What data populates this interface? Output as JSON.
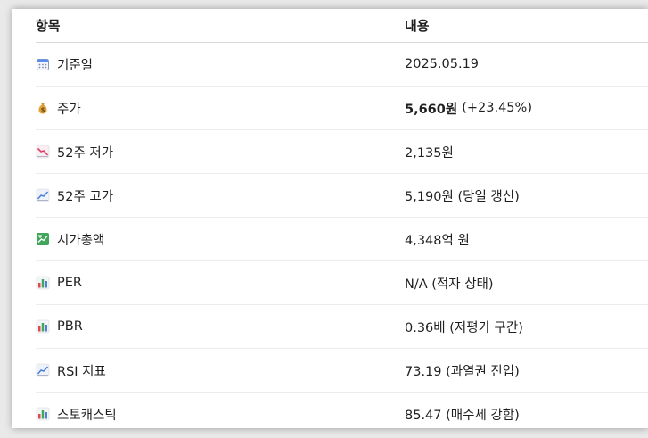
{
  "header": {
    "col1": "항목",
    "col2": "내용"
  },
  "rows": [
    {
      "icon": "calendar-icon",
      "label": "기준일",
      "value": "2025.05.19"
    },
    {
      "icon": "money-bag-icon",
      "label": "주가",
      "value_bold": "5,660원",
      "value": "(+23.45%)"
    },
    {
      "icon": "chart-decreasing-icon",
      "label": "52주 저가",
      "value": "2,135원"
    },
    {
      "icon": "chart-increasing-icon",
      "label": "52주 고가",
      "value": "5,190원 (당일 갱신)"
    },
    {
      "icon": "chart-yen-icon",
      "label": "시가총액",
      "value": "4,348억 원"
    },
    {
      "icon": "bar-chart-icon",
      "label": "PER",
      "value": "N/A (적자 상태)"
    },
    {
      "icon": "bar-chart-icon",
      "label": "PBR",
      "value": "0.36배 (저평가 구간)"
    },
    {
      "icon": "chart-increasing-icon",
      "label": "RSI 지표",
      "value": "73.19 (과열권 진입)"
    },
    {
      "icon": "bar-chart-icon",
      "label": "스토캐스틱",
      "value": "85.47 (매수세 강함)"
    }
  ]
}
